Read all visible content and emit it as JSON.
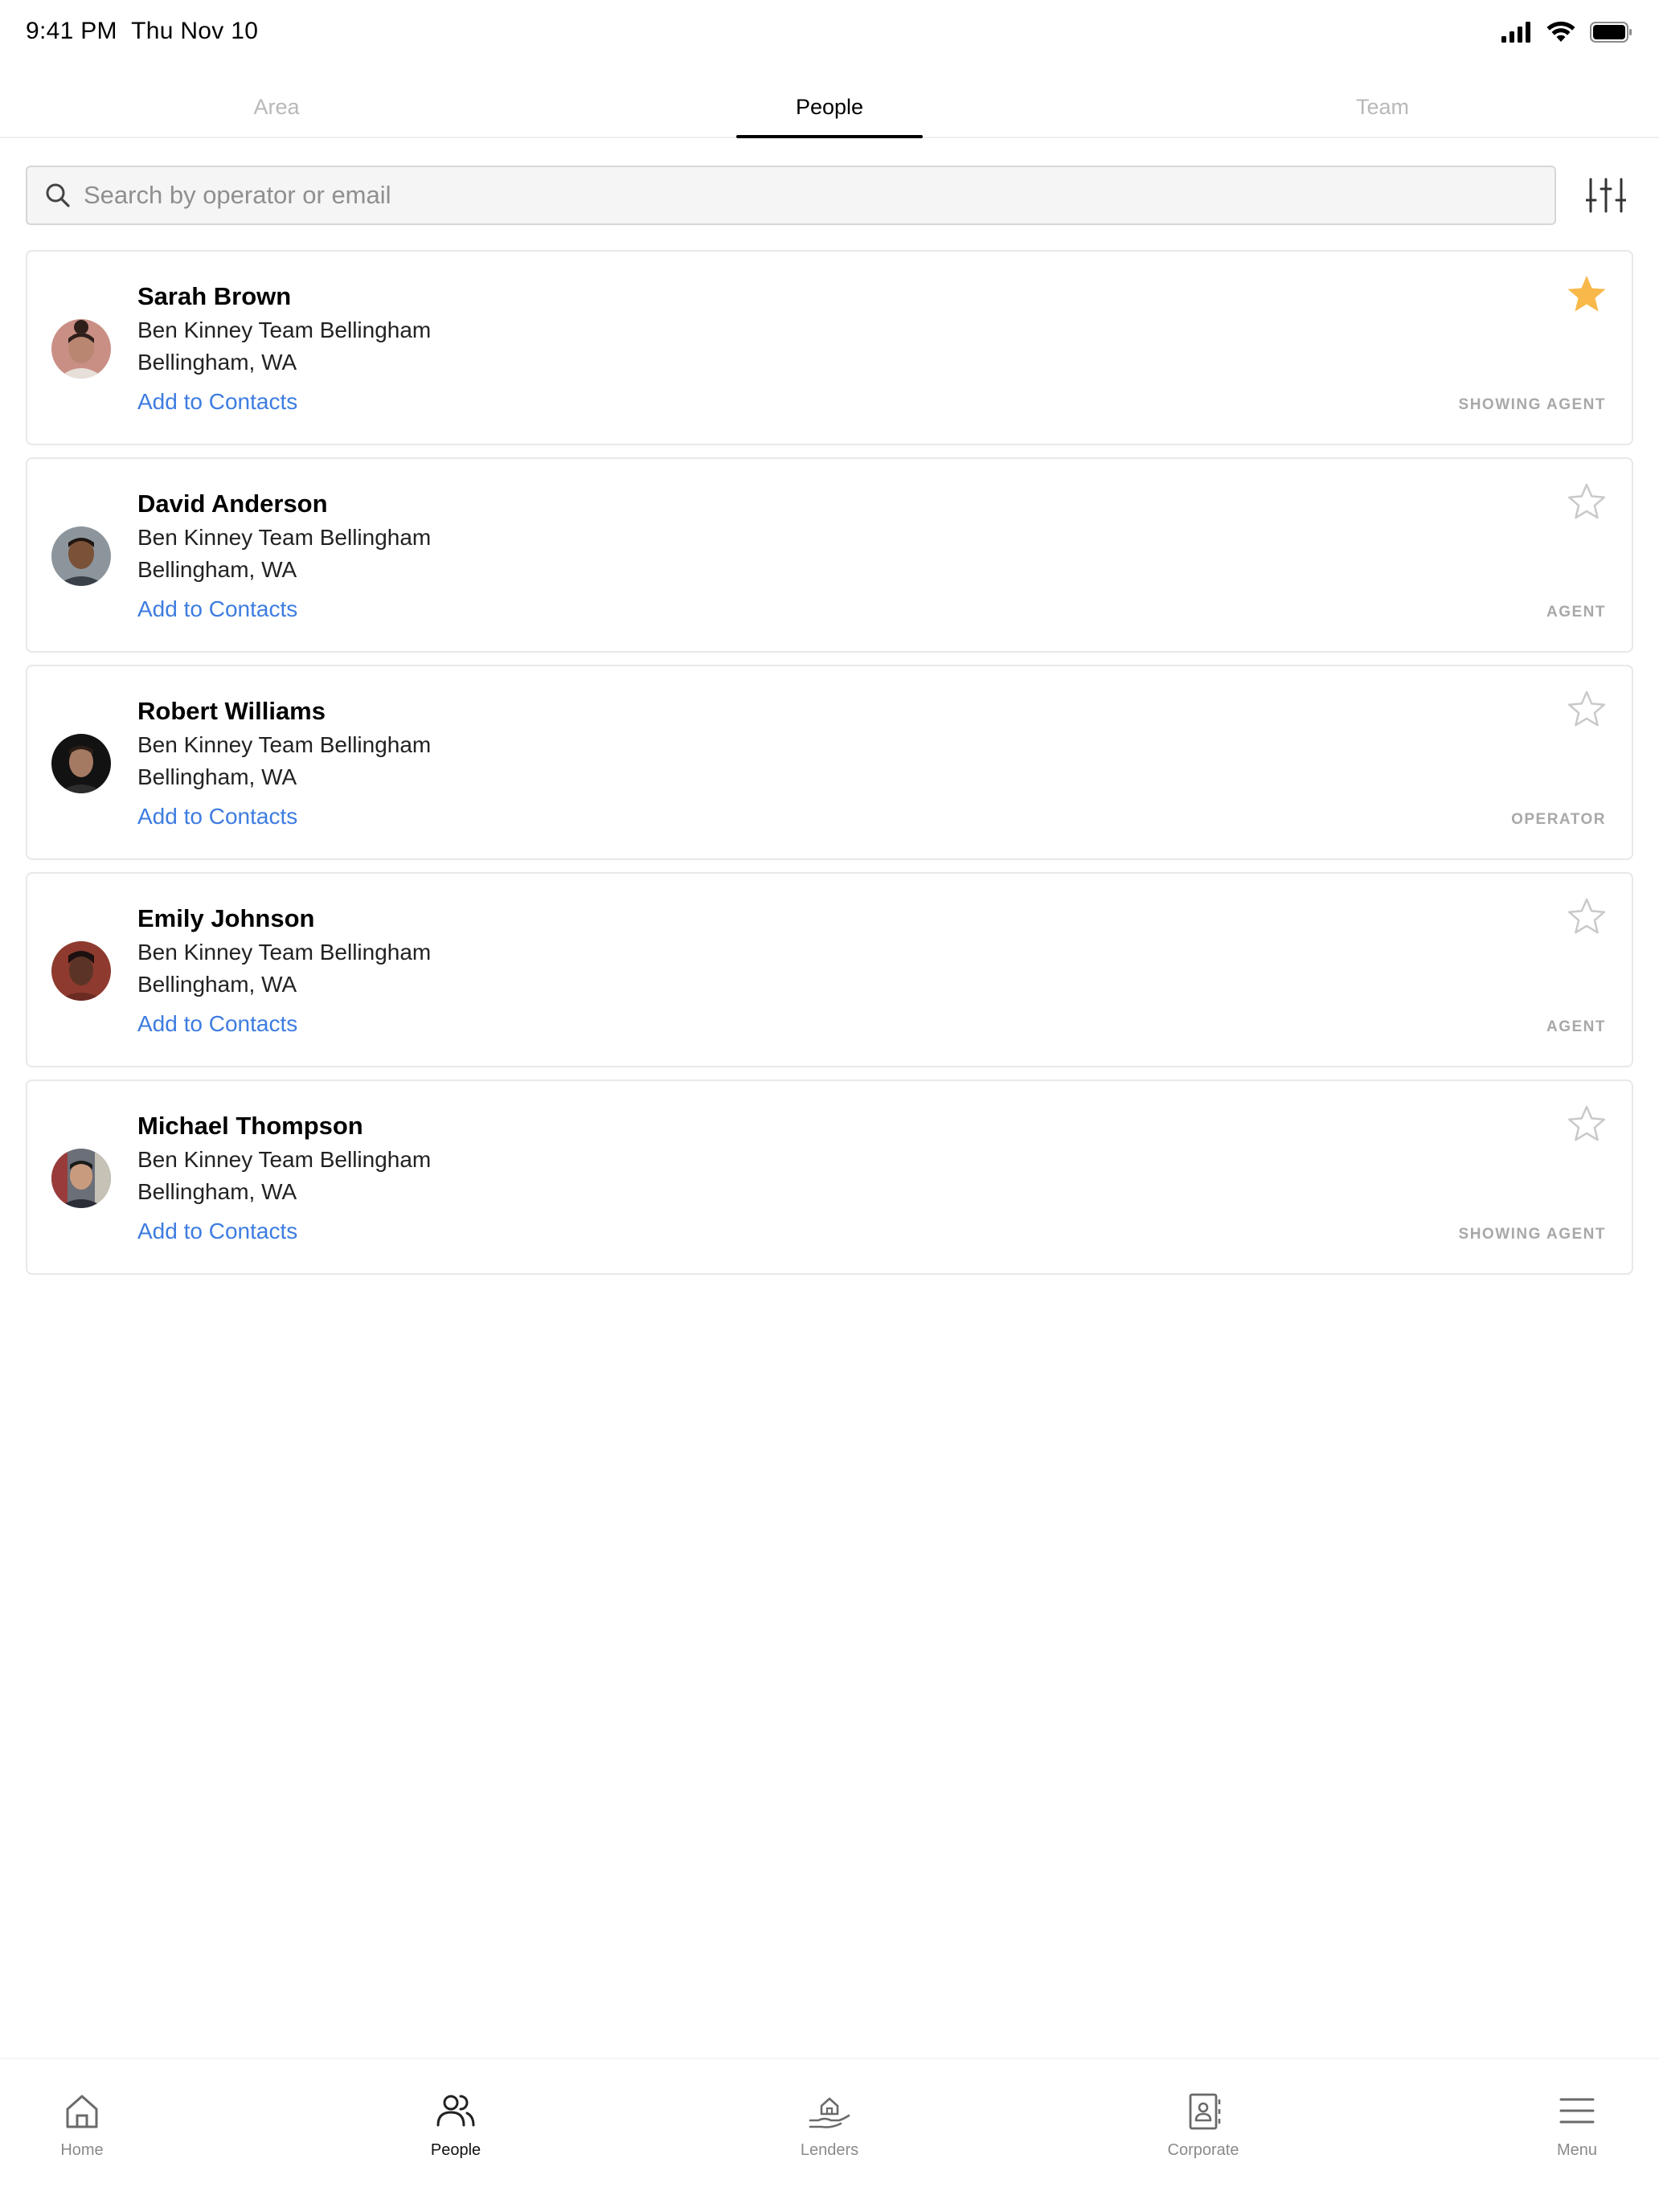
{
  "status_bar": {
    "time": "9:41 PM",
    "date": "Thu Nov 10",
    "icons": [
      "signal-icon",
      "wifi-icon",
      "battery-icon"
    ]
  },
  "tabs": [
    {
      "label": "Area",
      "active": false
    },
    {
      "label": "People",
      "active": true
    },
    {
      "label": "Team",
      "active": false
    }
  ],
  "search": {
    "placeholder": "Search by operator or email",
    "value": ""
  },
  "filter_icon": "sliders-icon",
  "colors": {
    "link": "#3d7ce0",
    "star_active": "#f9b84a",
    "star_inactive": "#c9c9c9"
  },
  "people": [
    {
      "name": "Sarah Brown",
      "team": "Ben Kinney Team Bellingham",
      "location": "Bellingham, WA",
      "action": "Add to Contacts",
      "role": "SHOWING AGENT",
      "favorite": true
    },
    {
      "name": "David Anderson",
      "team": "Ben Kinney Team Bellingham",
      "location": "Bellingham, WA",
      "action": "Add to Contacts",
      "role": "AGENT",
      "favorite": false
    },
    {
      "name": "Robert Williams",
      "team": "Ben Kinney Team Bellingham",
      "location": "Bellingham, WA",
      "action": "Add to Contacts",
      "role": "OPERATOR",
      "favorite": false
    },
    {
      "name": "Emily Johnson",
      "team": "Ben Kinney Team Bellingham",
      "location": "Bellingham, WA",
      "action": "Add to Contacts",
      "role": "AGENT",
      "favorite": false
    },
    {
      "name": "Michael Thompson",
      "team": "Ben Kinney Team Bellingham",
      "location": "Bellingham, WA",
      "action": "Add to Contacts",
      "role": "SHOWING AGENT",
      "favorite": false
    }
  ],
  "bottom_nav": [
    {
      "label": "Home",
      "icon": "home-icon",
      "active": false
    },
    {
      "label": "People",
      "icon": "people-icon",
      "active": true
    },
    {
      "label": "Lenders",
      "icon": "lenders-icon",
      "active": false
    },
    {
      "label": "Corporate",
      "icon": "corporate-icon",
      "active": false
    },
    {
      "label": "Menu",
      "icon": "menu-icon",
      "active": false
    }
  ]
}
